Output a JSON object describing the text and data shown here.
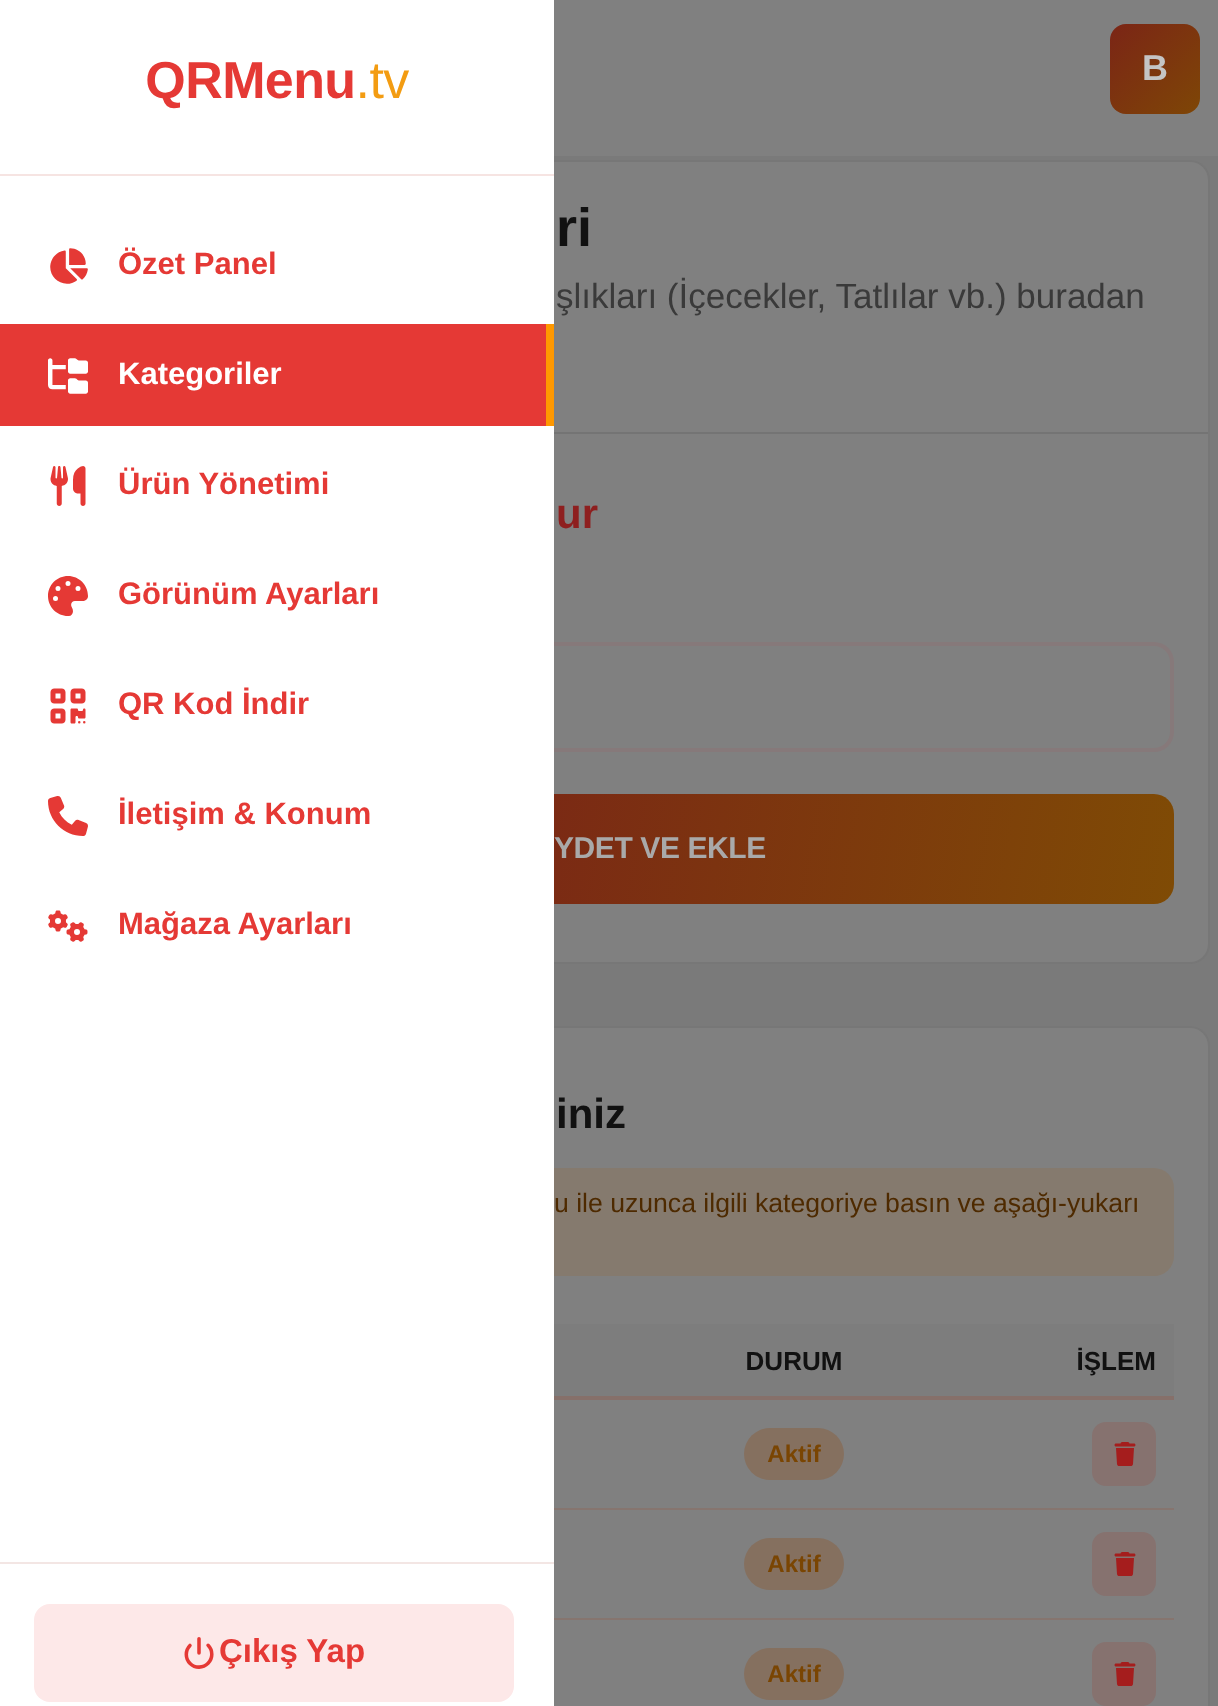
{
  "sidebar": {
    "logo": {
      "brand": "QRMenu",
      "suffix": ".tv"
    },
    "items": [
      {
        "label": "Özet Panel",
        "selected": false
      },
      {
        "label": "Kategoriler",
        "selected": true
      },
      {
        "label": "Ürün Yönetimi",
        "selected": false
      },
      {
        "label": "Görünüm Ayarları",
        "selected": false
      },
      {
        "label": "QR Kod İndir",
        "selected": false
      },
      {
        "label": "İletişim & Konum",
        "selected": false
      },
      {
        "label": "Mağaza Ayarları",
        "selected": false
      }
    ],
    "logout": "Çıkış Yap"
  },
  "topbar": {
    "avatar": "B"
  },
  "add_card": {
    "title": "ri",
    "subtitle": "şlıkları (İçecekler, Tatlılar vb.) buradan",
    "form_title": "ur",
    "button": "YDET VE EKLE"
  },
  "list_card": {
    "title": "iniz",
    "hint": "u ile uzunca ilgili kategoriye basın ve aşağı-yukarı",
    "table": {
      "columns": [
        "DURUM",
        "İŞLEM"
      ],
      "rows": [
        {
          "status": "Aktif"
        },
        {
          "status": "Aktif"
        },
        {
          "status": "Aktif"
        }
      ]
    }
  }
}
